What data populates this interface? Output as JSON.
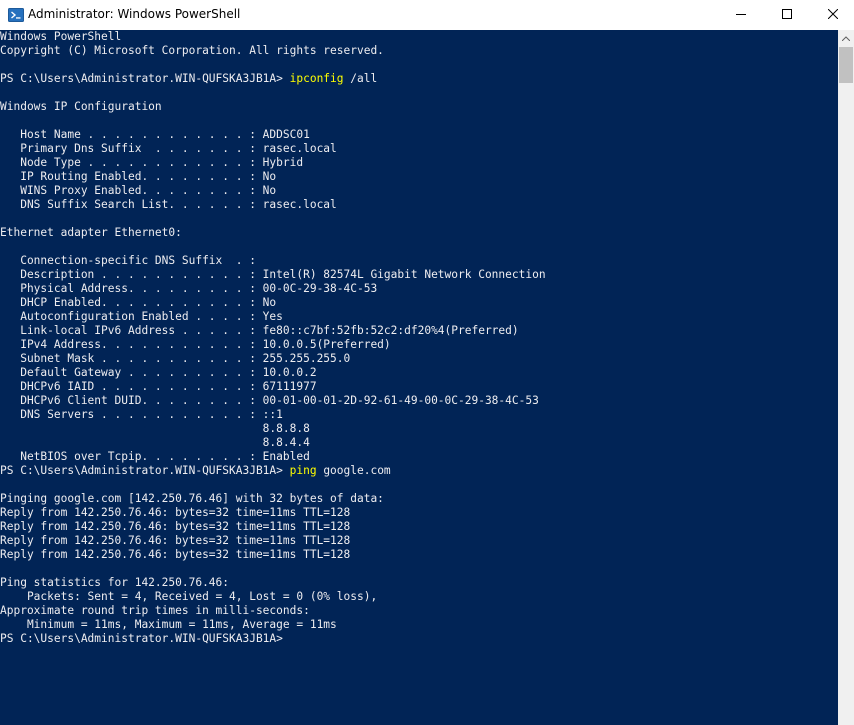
{
  "window": {
    "title": "Administrator: Windows PowerShell",
    "minimize_icon": "minimize-icon",
    "maximize_icon": "maximize-icon",
    "close_icon": "close-icon",
    "app_icon": "powershell-icon"
  },
  "console": {
    "background": "#012456",
    "foreground": "#eeedf0",
    "command_color": "#ffff00",
    "lines": [
      {
        "text": "Windows PowerShell"
      },
      {
        "text": "Copyright (C) Microsoft Corporation. All rights reserved."
      },
      {
        "text": ""
      },
      {
        "prompt": "PS C:\\Users\\Administrator.WIN-QUFSKA3JB1A> ",
        "command": "ipconfig",
        "args": " /all"
      },
      {
        "text": ""
      },
      {
        "text": "Windows IP Configuration"
      },
      {
        "text": ""
      },
      {
        "text": "   Host Name . . . . . . . . . . . . : ADDSC01"
      },
      {
        "text": "   Primary Dns Suffix  . . . . . . . : rasec.local"
      },
      {
        "text": "   Node Type . . . . . . . . . . . . : Hybrid"
      },
      {
        "text": "   IP Routing Enabled. . . . . . . . : No"
      },
      {
        "text": "   WINS Proxy Enabled. . . . . . . . : No"
      },
      {
        "text": "   DNS Suffix Search List. . . . . . : rasec.local"
      },
      {
        "text": ""
      },
      {
        "text": "Ethernet adapter Ethernet0:"
      },
      {
        "text": ""
      },
      {
        "text": "   Connection-specific DNS Suffix  . :"
      },
      {
        "text": "   Description . . . . . . . . . . . : Intel(R) 82574L Gigabit Network Connection"
      },
      {
        "text": "   Physical Address. . . . . . . . . : 00-0C-29-38-4C-53"
      },
      {
        "text": "   DHCP Enabled. . . . . . . . . . . : No"
      },
      {
        "text": "   Autoconfiguration Enabled . . . . : Yes"
      },
      {
        "text": "   Link-local IPv6 Address . . . . . : fe80::c7bf:52fb:52c2:df20%4(Preferred)"
      },
      {
        "text": "   IPv4 Address. . . . . . . . . . . : 10.0.0.5(Preferred)"
      },
      {
        "text": "   Subnet Mask . . . . . . . . . . . : 255.255.255.0"
      },
      {
        "text": "   Default Gateway . . . . . . . . . : 10.0.0.2"
      },
      {
        "text": "   DHCPv6 IAID . . . . . . . . . . . : 67111977"
      },
      {
        "text": "   DHCPv6 Client DUID. . . . . . . . : 00-01-00-01-2D-92-61-49-00-0C-29-38-4C-53"
      },
      {
        "text": "   DNS Servers . . . . . . . . . . . : ::1"
      },
      {
        "text": "                                       8.8.8.8"
      },
      {
        "text": "                                       8.8.4.4"
      },
      {
        "text": "   NetBIOS over Tcpip. . . . . . . . : Enabled"
      },
      {
        "prompt": "PS C:\\Users\\Administrator.WIN-QUFSKA3JB1A> ",
        "command": "ping",
        "args": " google.com"
      },
      {
        "text": ""
      },
      {
        "text": "Pinging google.com [142.250.76.46] with 32 bytes of data:"
      },
      {
        "text": "Reply from 142.250.76.46: bytes=32 time=11ms TTL=128"
      },
      {
        "text": "Reply from 142.250.76.46: bytes=32 time=11ms TTL=128"
      },
      {
        "text": "Reply from 142.250.76.46: bytes=32 time=11ms TTL=128"
      },
      {
        "text": "Reply from 142.250.76.46: bytes=32 time=11ms TTL=128"
      },
      {
        "text": ""
      },
      {
        "text": "Ping statistics for 142.250.76.46:"
      },
      {
        "text": "    Packets: Sent = 4, Received = 4, Lost = 0 (0% loss),"
      },
      {
        "text": "Approximate round trip times in milli-seconds:"
      },
      {
        "text": "    Minimum = 11ms, Maximum = 11ms, Average = 11ms"
      },
      {
        "prompt": "PS C:\\Users\\Administrator.WIN-QUFSKA3JB1A> ",
        "command": "",
        "args": ""
      }
    ]
  }
}
